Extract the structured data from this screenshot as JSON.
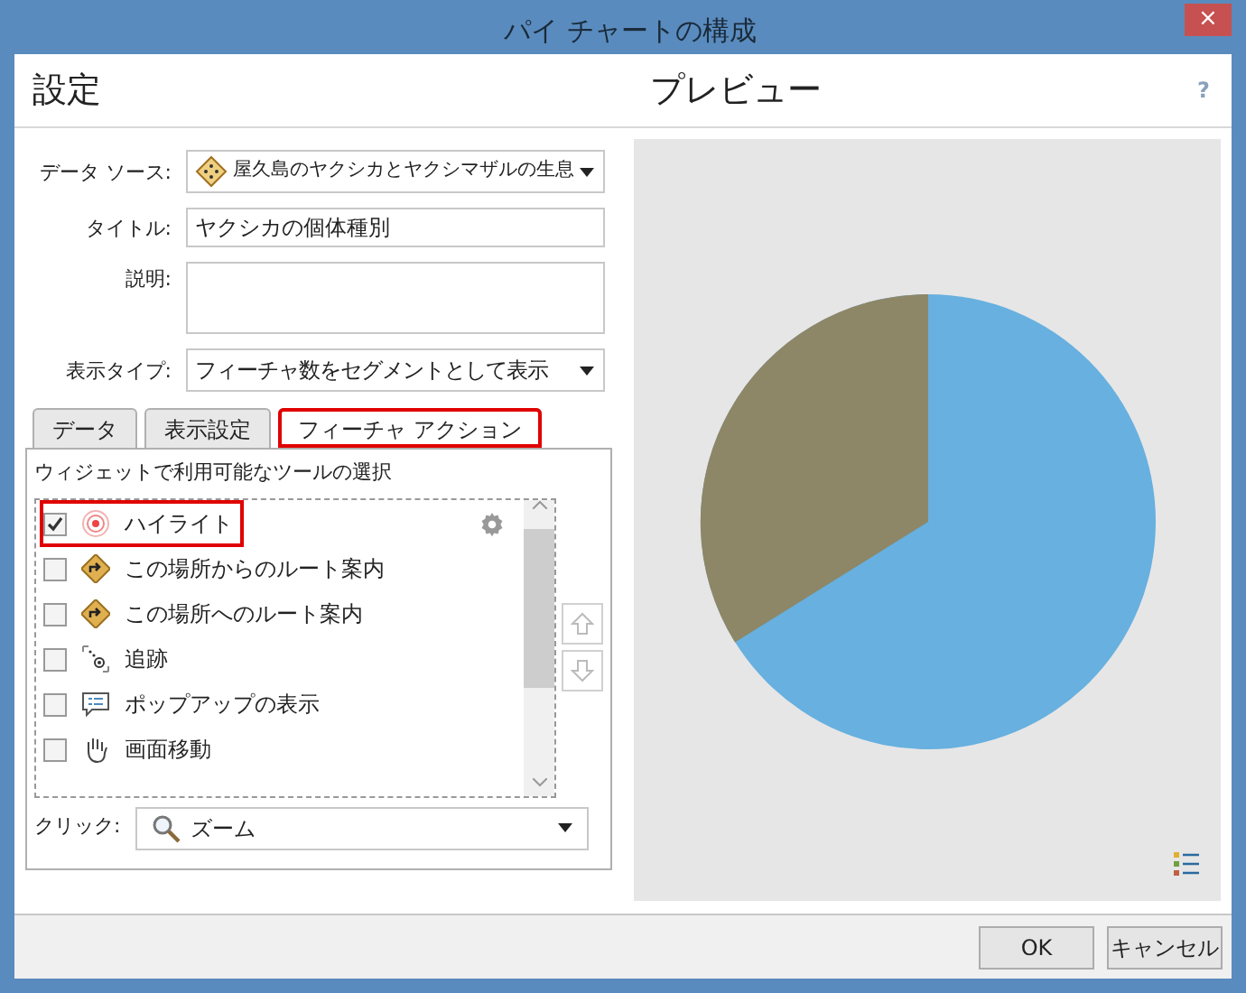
{
  "window": {
    "title": "パイ チャートの構成",
    "close": "×"
  },
  "settings": {
    "heading": "設定",
    "fields": [
      {
        "kind": "dropdown",
        "label": "データ ソース:",
        "value": "屋久島のヤクシカとヤクシマザルの生息"
      },
      {
        "kind": "text",
        "label": "タイトル:",
        "value": "ヤクシカの個体種別"
      },
      {
        "kind": "textarea",
        "label": "説明:"
      },
      {
        "kind": "dropdown",
        "label": "表示タイプ:",
        "value": "フィーチャ数をセグメントとして表示"
      }
    ],
    "tabs": [
      {
        "label": "データ",
        "selected": false,
        "callout": false
      },
      {
        "label": "表示設定",
        "selected": false,
        "callout": false
      },
      {
        "label": "フィーチャ アクション",
        "selected": true,
        "callout": true
      }
    ],
    "tools_caption": "ウィジェットで利用可能なツールの選択",
    "tools": [
      {
        "label": "ハイライト",
        "checked": true,
        "callout": true
      },
      {
        "label": "この場所からのルート案内",
        "checked": false,
        "callout": false
      },
      {
        "label": "この場所へのルート案内",
        "checked": false,
        "callout": false
      },
      {
        "label": "追跡",
        "checked": false,
        "callout": false
      },
      {
        "label": "ポップアップの表示",
        "checked": false,
        "callout": false
      },
      {
        "label": "画面移動",
        "checked": false,
        "callout": false
      }
    ],
    "click": {
      "label": "クリック:",
      "value": "ズーム"
    }
  },
  "preview": {
    "heading": "プレビュー",
    "help": "?"
  },
  "buttons": [
    "OK",
    "キャンセル"
  ]
}
